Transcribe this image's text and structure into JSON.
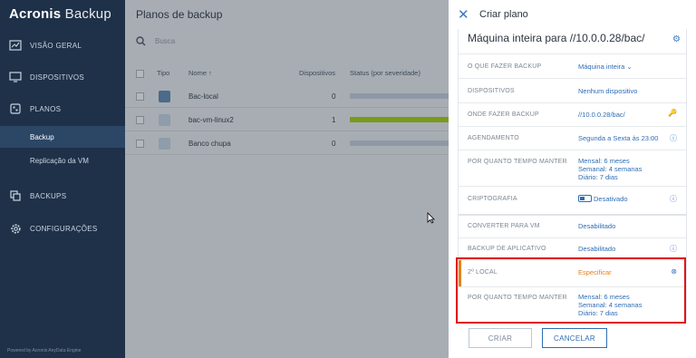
{
  "sidebar": {
    "brand_bold": "Acronis",
    "brand_rest": "Backup",
    "items": [
      {
        "label": "VISÃO GERAL",
        "icon": "dashboard-icon"
      },
      {
        "label": "DISPOSITIVOS",
        "icon": "monitor-icon"
      },
      {
        "label": "PLANOS",
        "icon": "plans-icon"
      },
      {
        "label": "BACKUPS",
        "icon": "backups-icon"
      },
      {
        "label": "CONFIGURAÇÕES",
        "icon": "gear-icon"
      }
    ],
    "sub_items": [
      {
        "label": "Backup",
        "active": true
      },
      {
        "label": "Replicação da VM",
        "active": false
      }
    ],
    "powered_by": "Powered by Acronis AnyData Engine"
  },
  "main": {
    "title": "Planos de backup",
    "search_placeholder": "Busca",
    "columns": {
      "type": "Tipo",
      "name": "Nome ↑",
      "devices": "Dispositivos",
      "status": "Status (por severidade)"
    },
    "rows": [
      {
        "name": "Bac-local",
        "devices": "0",
        "status": "gray"
      },
      {
        "name": "bac-vm-linux2",
        "devices": "1",
        "status": "green"
      },
      {
        "name": "Banco chupa",
        "devices": "0",
        "status": "gray"
      }
    ]
  },
  "panel": {
    "title": "Criar plano",
    "plan_name": "Máquina inteira para //10.0.0.28/bac/",
    "rows": {
      "what": {
        "label": "O QUE FAZER BACKUP",
        "value": "Máquina inteira ⌄"
      },
      "devices": {
        "label": "DISPOSITIVOS",
        "value": "Nenhum dispositivo"
      },
      "where": {
        "label": "ONDE FAZER BACKUP",
        "value": "//10.0.0.28/bac/"
      },
      "schedule": {
        "label": "AGENDAMENTO",
        "value": "Segunda a Sexta às 23:00"
      },
      "retention": {
        "label": "POR QUANTO TEMPO MANTER",
        "line1": "Mensal: 6 meses",
        "line2": "Semanal: 4 semanas",
        "line3": "Diário: 7 dias"
      },
      "encryption": {
        "label": "CRIPTOGRAFIA",
        "value": "Desativado"
      },
      "convert": {
        "label": "CONVERTER PARA VM",
        "value": "Desabilitado"
      },
      "appbackup": {
        "label": "BACKUP DE APLICATIVO",
        "value": "Desabilitado"
      },
      "second_location": {
        "label": "2º LOCAL",
        "value": "Especificar"
      },
      "retention2": {
        "label": "POR QUANTO TEMPO MANTER",
        "line1": "Mensal: 6 meses",
        "line2": "Semanal: 4 semanas",
        "line3": "Diário: 7 dias"
      }
    },
    "buttons": {
      "create": "CRIAR",
      "cancel": "CANCELAR"
    }
  },
  "colors": {
    "sidebar": "#1f3148",
    "accent": "#2f6db5",
    "orange": "#e8811a",
    "highlight": "#e0121c"
  }
}
